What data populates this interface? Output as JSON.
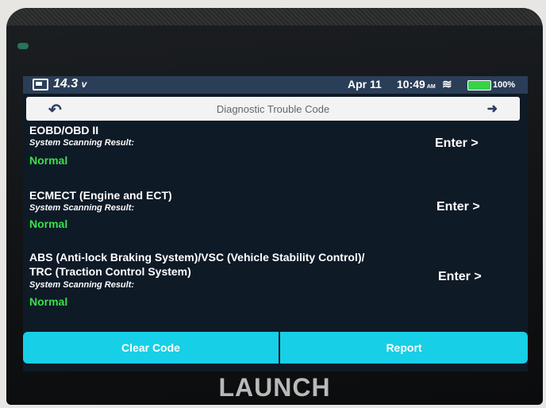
{
  "status_bar": {
    "voltage": "14.3",
    "voltage_unit": "v",
    "date": "Apr 11",
    "time": "10:49",
    "time_suffix": "AM",
    "battery_percent": "100%"
  },
  "title_bar": {
    "title": "Diagnostic Trouble Code"
  },
  "systems": [
    {
      "name": "EOBD/OBD II",
      "label": "System Scanning Result:",
      "status": "Normal",
      "action": "Enter >"
    },
    {
      "name": "ECMECT (Engine and ECT)",
      "label": "System Scanning Result:",
      "status": "Normal",
      "action": "Enter >"
    },
    {
      "name_line1": "ABS (Anti-lock Braking System)/VSC (Vehicle Stability Control)/",
      "name_line2": "TRC (Traction Control System)",
      "label": "System Scanning Result:",
      "status": "Normal",
      "action": "Enter >"
    }
  ],
  "bottom_bar": {
    "clear_label": "Clear Code",
    "report_label": "Report"
  },
  "brand": "LAUNCH",
  "colors": {
    "accent": "#17cfe6",
    "status_normal": "#39e04b",
    "status_bar": "#2b3e58",
    "battery": "#35d24a"
  }
}
